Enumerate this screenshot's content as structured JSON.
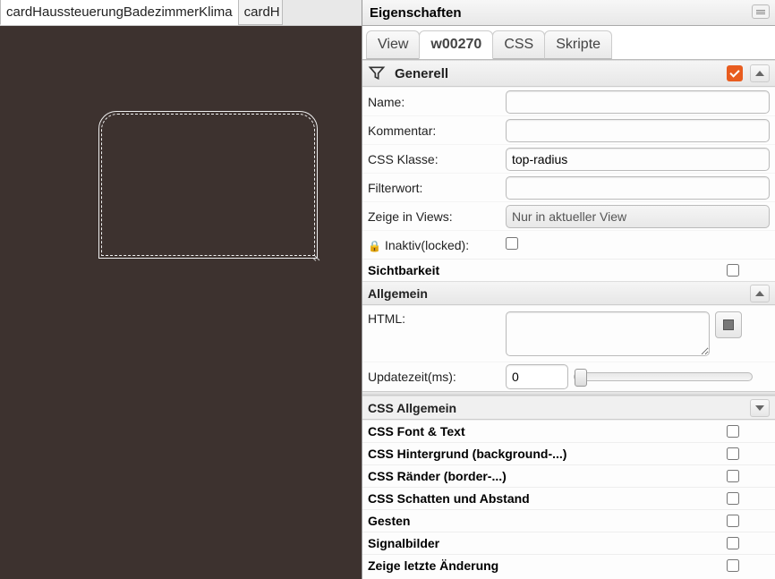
{
  "canvas": {
    "tabs": [
      {
        "label": "cardHaussteuerungBadezimmerKlima",
        "active": true
      },
      {
        "label": "cardH",
        "active": false
      }
    ]
  },
  "panel": {
    "title": "Eigenschaften",
    "mode_tabs": {
      "view": "View",
      "widget": "w00270",
      "css": "CSS",
      "scripts": "Skripte"
    },
    "sections": {
      "general": {
        "title": "Generell",
        "name_label": "Name:",
        "name_value": "",
        "comment_label": "Kommentar:",
        "comment_value": "",
        "cssclass_label": "CSS Klasse:",
        "cssclass_value": "top-radius",
        "filterword_label": "Filterwort:",
        "filterword_value": "",
        "showinviews_label": "Zeige in Views:",
        "showinviews_value": "Nur in aktueller View",
        "inactive_label": "Inaktiv(locked):"
      },
      "visibility": {
        "title": "Sichtbarkeit"
      },
      "common": {
        "title": "Allgemein",
        "html_label": "HTML:",
        "html_value": "",
        "update_label": "Updatezeit(ms):",
        "update_value": "0"
      },
      "css_general": {
        "title": "CSS Allgemein"
      },
      "toggles": {
        "font": "CSS Font & Text",
        "background": "CSS Hintergrund (background-...)",
        "border": "CSS Ränder (border-...)",
        "shadow": "CSS Schatten und Abstand",
        "gestures": "Gesten",
        "signals": "Signalbilder",
        "lastchange": "Zeige letzte Änderung"
      }
    }
  }
}
